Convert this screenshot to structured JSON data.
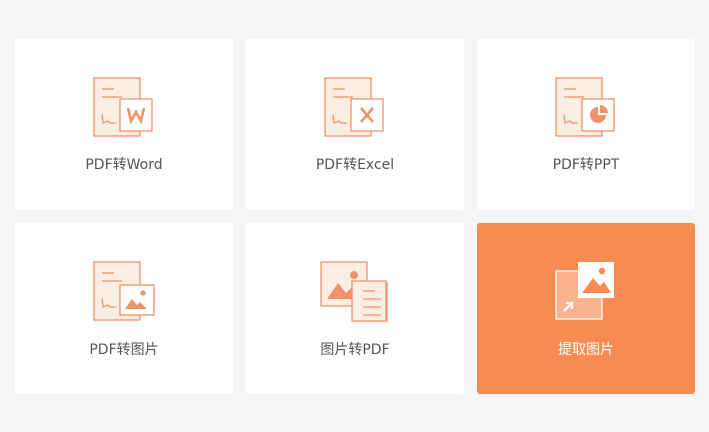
{
  "accent_color": "#f88b51",
  "tools": [
    {
      "label": "PDF转Word",
      "icon": "pdf-to-word-icon"
    },
    {
      "label": "PDF转Excel",
      "icon": "pdf-to-excel-icon"
    },
    {
      "label": "PDF转PPT",
      "icon": "pdf-to-ppt-icon"
    },
    {
      "label": "PDF转图片",
      "icon": "pdf-to-image-icon"
    },
    {
      "label": "图片转PDF",
      "icon": "image-to-pdf-icon"
    },
    {
      "label": "提取图片",
      "icon": "extract-image-icon",
      "active": true
    }
  ]
}
